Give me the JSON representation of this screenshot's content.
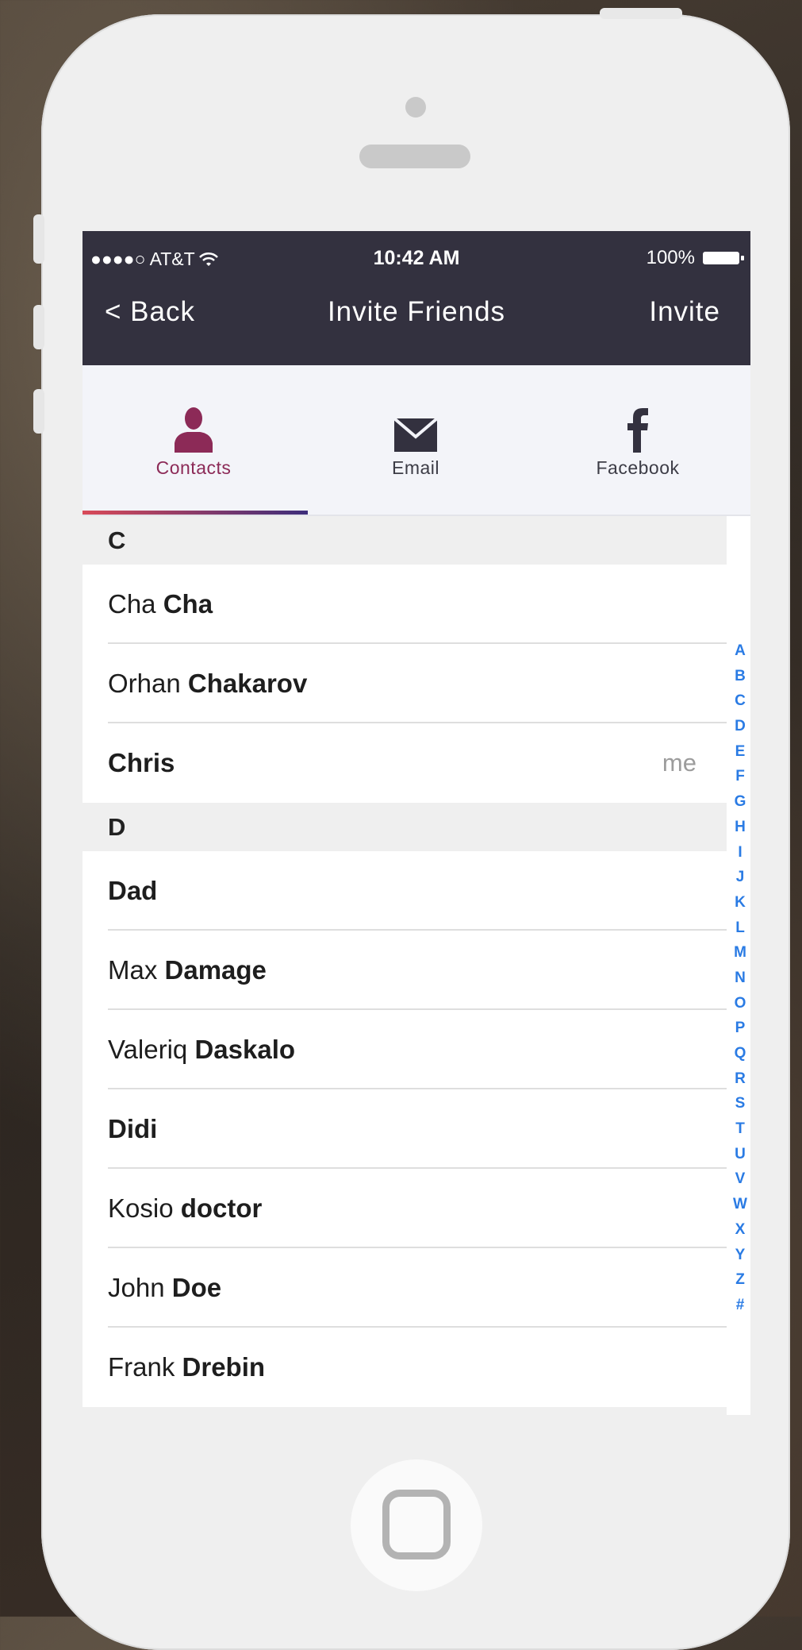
{
  "status": {
    "carrier": "●●●●○ AT&T",
    "time": "10:42 AM",
    "battery": "100%"
  },
  "nav": {
    "back": "< Back",
    "title": "Invite Friends",
    "action": "Invite"
  },
  "tabs": [
    {
      "label": "Contacts",
      "icon": "person-icon",
      "active": true
    },
    {
      "label": "Email",
      "icon": "envelope-icon",
      "active": false
    },
    {
      "label": "Facebook",
      "icon": "facebook-icon",
      "active": false
    }
  ],
  "sections": [
    {
      "letter": "C",
      "contacts": [
        {
          "first": "Cha",
          "last": "Cha",
          "tag": ""
        },
        {
          "first": "Orhan",
          "last": "Chakarov",
          "tag": ""
        },
        {
          "first": "",
          "last": "Chris",
          "tag": "me"
        }
      ]
    },
    {
      "letter": "D",
      "contacts": [
        {
          "first": "",
          "last": "Dad",
          "tag": ""
        },
        {
          "first": "Max",
          "last": "Damage",
          "tag": ""
        },
        {
          "first": "Valeriq",
          "last": "Daskalo",
          "tag": ""
        },
        {
          "first": "",
          "last": "Didi",
          "tag": ""
        },
        {
          "first": "Kosio",
          "last": "doctor",
          "tag": ""
        },
        {
          "first": "John",
          "last": "Doe",
          "tag": ""
        },
        {
          "first": "Frank",
          "last": "Drebin",
          "tag": ""
        }
      ]
    }
  ],
  "index_letters": [
    "A",
    "B",
    "C",
    "D",
    "E",
    "F",
    "G",
    "H",
    "I",
    "J",
    "K",
    "L",
    "M",
    "N",
    "O",
    "P",
    "Q",
    "R",
    "S",
    "T",
    "U",
    "V",
    "W",
    "X",
    "Y",
    "Z",
    "#"
  ],
  "colors": {
    "navbar": "#33313f",
    "accent": "#8c2a57",
    "index": "#2a7be4"
  }
}
